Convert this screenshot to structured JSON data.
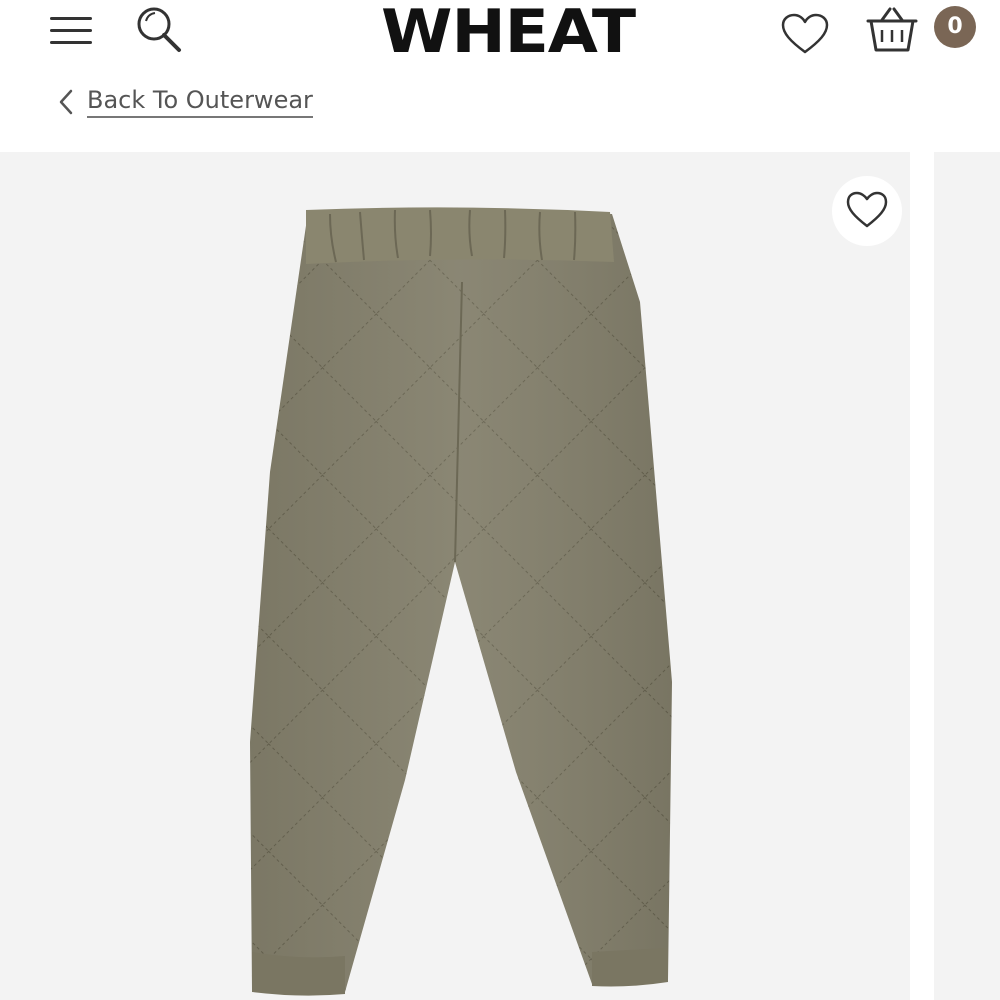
{
  "header": {
    "brand": "WHEAT",
    "menu_icon": "hamburger-menu-icon",
    "search_icon": "search-icon",
    "wishlist_icon": "heart-icon",
    "basket_icon": "basket-icon",
    "basket_count": "0"
  },
  "breadcrumb": {
    "back_icon": "chevron-left-icon",
    "back_label": "Back To Outerwear"
  },
  "product_gallery": {
    "image": "quilted-pants-image",
    "favorite_icon": "heart-icon"
  },
  "colors": {
    "accent_badge": "#7a6655",
    "gallery_background": "#f3f3f3",
    "product_fabric": "#837f6b"
  }
}
